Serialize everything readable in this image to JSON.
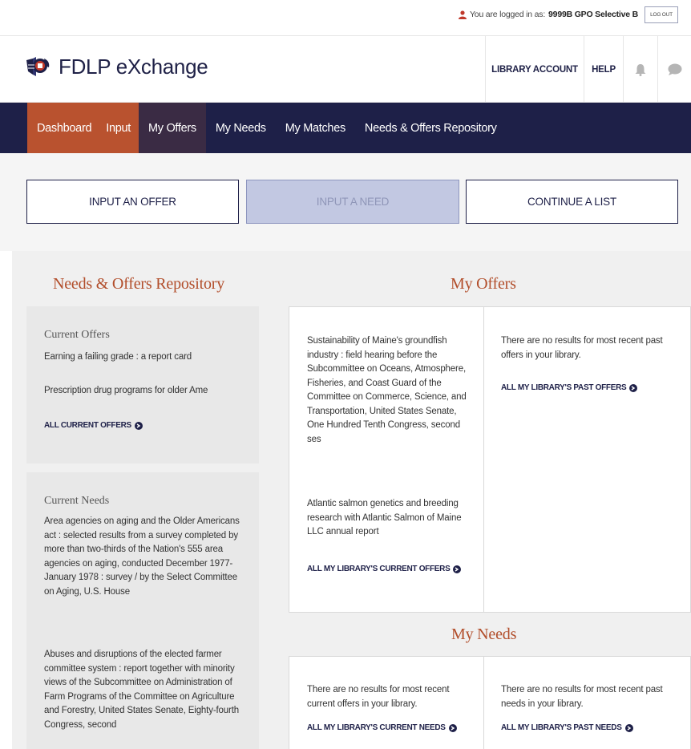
{
  "topbar": {
    "login_prefix": "You are logged in as:",
    "login_user": "9999B GPO Selective B",
    "logout_label": "LOG OUT",
    "user_icon_color": "#c0392b"
  },
  "header": {
    "brand": "FDLP eXchange",
    "nav": {
      "library_account": "LIBRARY ACCOUNT",
      "help": "HELP",
      "bell_icon": "bell-icon",
      "chat_icon": "chat-icon"
    }
  },
  "mainnav": {
    "items": [
      {
        "label": "Dashboard"
      },
      {
        "label": "Input"
      },
      {
        "label": "My Offers"
      },
      {
        "label": "My Needs"
      },
      {
        "label": "My Matches"
      },
      {
        "label": "Needs & Offers Repository"
      }
    ],
    "colors": {
      "bar": "#1e2048",
      "active_orange": "#b9522f",
      "active_dark": "#3a2b44"
    }
  },
  "actions": {
    "input_offer": "INPUT AN OFFER",
    "input_need": "INPUT A NEED",
    "continue_list": "CONTINUE A LIST"
  },
  "repository": {
    "title": "Needs & Offers Repository",
    "current_offers": {
      "title": "Current Offers",
      "items": [
        "Earning a failing grade : a report card",
        "Prescription drug programs for older Ame"
      ],
      "link": "ALL CURRENT OFFERS"
    },
    "current_needs": {
      "title": "Current Needs",
      "items": [
        "Area agencies on aging and the Older Americans act : selected results from a survey completed by more than two-thirds of the Nation's 555 area agencies on aging, conducted December 1977-January 1978 : survey / by the Select Committee on Aging, U.S. House",
        "Abuses and disruptions of the elected farmer committee system : report together with minority views of the Subcommittee on Administration of Farm Programs of the Committee on Agriculture and Forestry, United States Senate, Eighty-fourth Congress, second"
      ]
    }
  },
  "my_offers": {
    "title": "My Offers",
    "current_items": [
      "Sustainability of Maine's groundfish industry : field hearing before the Subcommittee on Oceans, Atmosphere, Fisheries, and Coast Guard of the Committee on Commerce, Science, and Transportation, United States Senate, One Hundred Tenth Congress, second ses",
      "Atlantic salmon genetics and breeding research with Atlantic Salmon of Maine LLC annual report"
    ],
    "current_link": "ALL MY LIBRARY'S CURRENT OFFERS",
    "past_empty": "There are no results for most recent past offers in your library.",
    "past_link": "ALL MY LIBRARY'S PAST OFFERS"
  },
  "my_needs": {
    "title": "My Needs",
    "current_empty": "There are no results for most recent current offers in your library.",
    "current_link": "ALL MY LIBRARY'S CURRENT NEEDS",
    "past_empty": "There are no results for most recent past needs in your library.",
    "past_link": "ALL MY LIBRARY'S PAST NEEDS"
  },
  "colors": {
    "accent": "#b24e2b",
    "navy": "#1e2048"
  }
}
